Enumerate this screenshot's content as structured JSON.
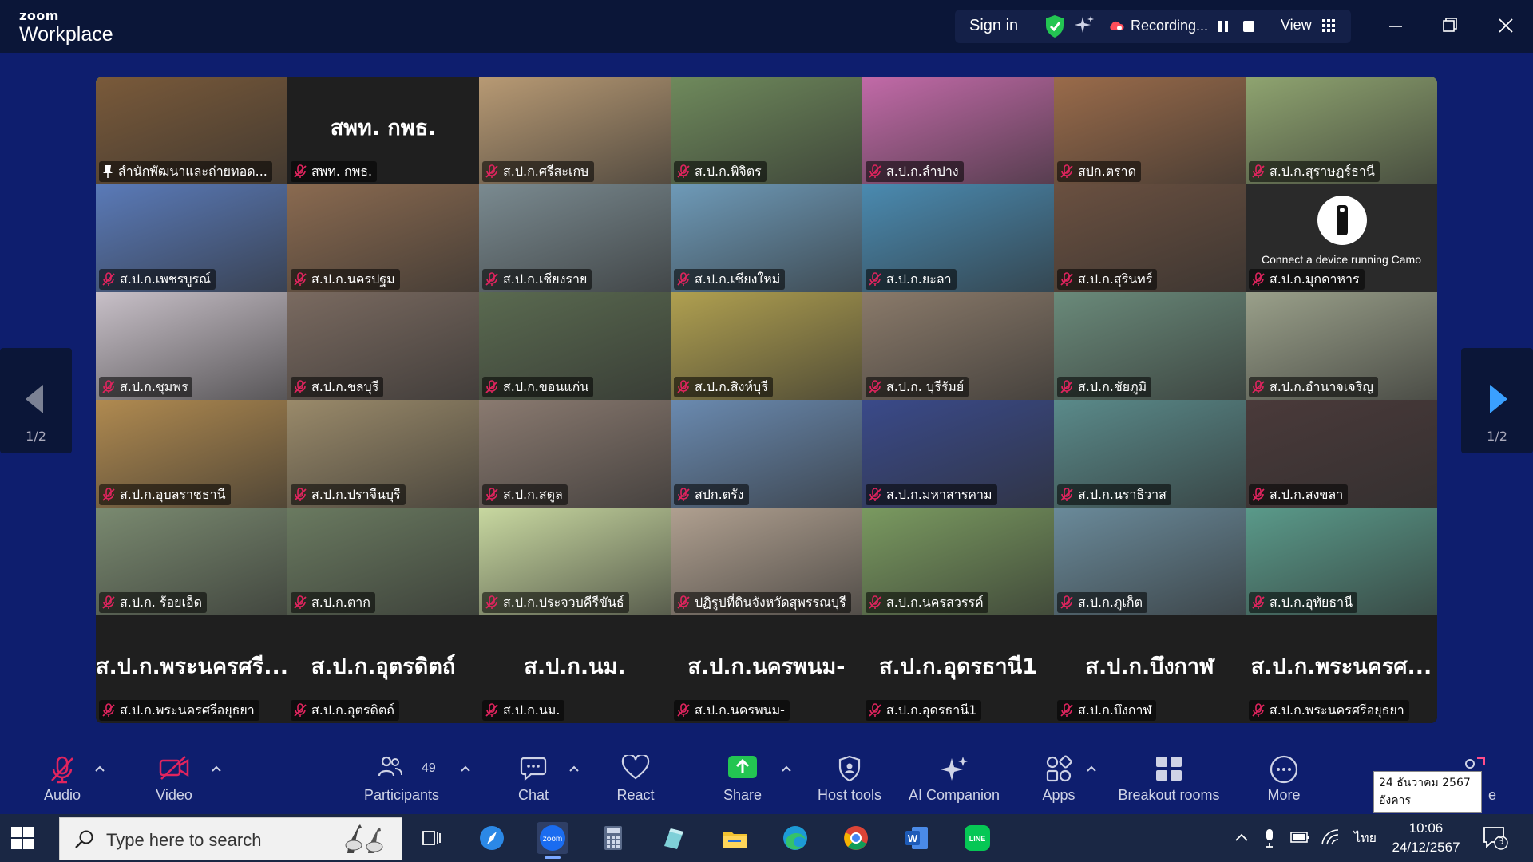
{
  "app": {
    "brand_small": "zoom",
    "brand_large": "Workplace"
  },
  "topbar": {
    "signin": "Sign in",
    "recording_label": "Recording...",
    "view_label": "View"
  },
  "participants_tiles": [
    {
      "label": "สำนักพัฒนาและถ่ายทอด...",
      "type": "video",
      "active": true,
      "pinned": true,
      "bg": "#7a5a3a"
    },
    {
      "label": "สพท. กพธ.",
      "type": "name",
      "display": "สพท. กพธ.",
      "bg": "#1f1f1f"
    },
    {
      "label": "ส.ป.ก.ศรีสะเกษ",
      "type": "video",
      "bg": "#b89a74"
    },
    {
      "label": "ส.ป.ก.พิจิตร",
      "type": "video",
      "bg": "#6f8a5c"
    },
    {
      "label": "ส.ป.ก.ลำปาง",
      "type": "video",
      "bg": "#c26aa8"
    },
    {
      "label": "สปก.ตราด",
      "type": "video",
      "bg": "#9a6b4a"
    },
    {
      "label": "ส.ป.ก.สุราษฎร์ธานี",
      "type": "video",
      "bg": "#8fa470"
    },
    {
      "label": "ส.ป.ก.เพชรบูรณ์",
      "type": "video",
      "bg": "#5a7ab8"
    },
    {
      "label": "ส.ป.ก.นครปฐม",
      "type": "video",
      "bg": "#8a6a50"
    },
    {
      "label": "ส.ป.ก.เชียงราย",
      "type": "video",
      "bg": "#7a8a90"
    },
    {
      "label": "ส.ป.ก.เชียงใหม่",
      "type": "video",
      "bg": "#6e9ab8"
    },
    {
      "label": "ส.ป.ก.ยะลา",
      "type": "video",
      "bg": "#4a8ab0"
    },
    {
      "label": "ส.ป.ก.สุรินทร์",
      "type": "video",
      "bg": "#6a5040"
    },
    {
      "label": "ส.ป.ก.มุกดาหาร",
      "type": "camo",
      "display": "Connect a device running Camo",
      "bg": "#2a2a2a"
    },
    {
      "label": "ส.ป.ก.ชุมพร",
      "type": "video",
      "bg": "#c8c0c8"
    },
    {
      "label": "ส.ป.ก.ชลบุรี",
      "type": "video",
      "bg": "#7a6a60"
    },
    {
      "label": "ส.ป.ก.ขอนแก่น",
      "type": "video",
      "bg": "#5a6a50"
    },
    {
      "label": "ส.ป.ก.สิงห์บุรี",
      "type": "video",
      "bg": "#b0a050"
    },
    {
      "label": "ส.ป.ก. บุรีรัมย์",
      "type": "video",
      "bg": "#8a7a6a"
    },
    {
      "label": "ส.ป.ก.ชัยภูมิ",
      "type": "video",
      "bg": "#6a8a7a"
    },
    {
      "label": "ส.ป.ก.อำนาจเจริญ",
      "type": "video",
      "bg": "#9aa08a"
    },
    {
      "label": "ส.ป.ก.อุบลราชธานี",
      "type": "video",
      "bg": "#b08a50"
    },
    {
      "label": "ส.ป.ก.ปราจีนบุรี",
      "type": "video",
      "bg": "#9a8a6a"
    },
    {
      "label": "ส.ป.ก.สตูล",
      "type": "video",
      "bg": "#8a7a70"
    },
    {
      "label": "สปก.ตรัง",
      "type": "video",
      "bg": "#6a8ab0"
    },
    {
      "label": "ส.ป.ก.มหาสารคาม",
      "type": "video",
      "bg": "#3a4a8a"
    },
    {
      "label": "ส.ป.ก.นราธิวาส",
      "type": "video",
      "bg": "#5a8a8a"
    },
    {
      "label": "ส.ป.ก.สงขลา",
      "type": "video",
      "bg": "#4a3a3a"
    },
    {
      "label": "ส.ป.ก. ร้อยเอ็ด",
      "type": "video",
      "bg": "#7a8a70"
    },
    {
      "label": "ส.ป.ก.ตาก",
      "type": "video",
      "bg": "#6a7a60"
    },
    {
      "label": "ส.ป.ก.ประจวบคีรีขันธ์",
      "type": "video",
      "bg": "#c8d8a0"
    },
    {
      "label": "ปฏิรูปที่ดินจังหวัดสุพรรณบุรี",
      "type": "video",
      "bg": "#b0a090"
    },
    {
      "label": "ส.ป.ก.นครสวรรค์",
      "type": "video",
      "bg": "#7a9a60"
    },
    {
      "label": "ส.ป.ก.ภูเก็ต",
      "type": "video",
      "bg": "#6a8a9a"
    },
    {
      "label": "ส.ป.ก.อุทัยธานี",
      "type": "video",
      "bg": "#5a9a8a"
    },
    {
      "label": "ส.ป.ก.พระนครศรีอยุธยา",
      "type": "name",
      "display": "ส.ป.ก.พระนครศรี...",
      "bg": "#1f1f1f"
    },
    {
      "label": "ส.ป.ก.อุตรดิตถ์",
      "type": "name",
      "display": "ส.ป.ก.อุตรดิตถ์",
      "bg": "#1f1f1f"
    },
    {
      "label": "ส.ป.ก.นม.",
      "type": "name",
      "display": "ส.ป.ก.นม.",
      "bg": "#1f1f1f"
    },
    {
      "label": "ส.ป.ก.นครพนม-",
      "type": "name",
      "display": "ส.ป.ก.นครพนม-",
      "bg": "#1f1f1f"
    },
    {
      "label": "ส.ป.ก.อุดรธานี1",
      "type": "name",
      "display": "ส.ป.ก.อุดรธานี1",
      "bg": "#1f1f1f"
    },
    {
      "label": "ส.ป.ก.บึงกาฬ",
      "type": "name",
      "display": "ส.ป.ก.บึงกาฬ",
      "bg": "#1f1f1f"
    },
    {
      "label": "ส.ป.ก.พระนครศรีอยุธยา",
      "type": "name",
      "display": "ส.ป.ก.พระนครศ...",
      "bg": "#1f1f1f"
    }
  ],
  "pager": {
    "left": "1/2",
    "right": "1/2"
  },
  "toolbar": {
    "audio": "Audio",
    "video": "Video",
    "participants": "Participants",
    "participants_count": "49",
    "chat": "Chat",
    "react": "React",
    "share": "Share",
    "host_tools": "Host tools",
    "ai_companion": "AI Companion",
    "apps": "Apps",
    "breakout_rooms": "Breakout rooms",
    "more": "More",
    "leave_partial": "e"
  },
  "tooltip": {
    "date_thai": "24 ธันวาคม 2567",
    "day_thai": "อังคาร"
  },
  "taskbar": {
    "search_placeholder": "Type here to search",
    "language": "ไทย",
    "time": "10:06",
    "date": "24/12/2567",
    "notification_count": "3"
  },
  "colors": {
    "zoom_blue": "#0e1e6e",
    "titlebar": "#0b1638",
    "active_border": "#2ed47a",
    "mic_off_red": "#e0245e",
    "share_green": "#23c552"
  }
}
